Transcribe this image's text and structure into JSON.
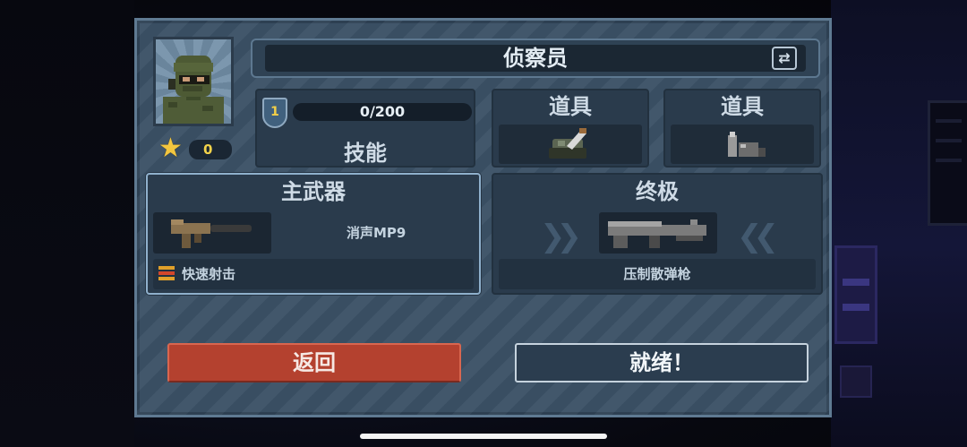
{
  "character": {
    "name": "侦察员",
    "stars": "0",
    "level": "1",
    "xp": "0/200",
    "skill_label": "技能",
    "swap_icon": "swap-icon"
  },
  "items": [
    {
      "label": "道具",
      "icon": "grenade-icon"
    },
    {
      "label": "道具",
      "icon": "ammo-icon"
    }
  ],
  "main_weapon": {
    "header": "主武器",
    "name": "消声MP9",
    "perk": "快速射击",
    "icon": "smg-icon"
  },
  "ultimate": {
    "header": "终极",
    "name": "压制散弹枪",
    "icon": "shotgun-icon"
  },
  "buttons": {
    "back": "返回",
    "ready": "就绪！"
  },
  "colors": {
    "panel": "#3b5166",
    "back_button": "#b4412f",
    "star": "#f3c63f"
  }
}
